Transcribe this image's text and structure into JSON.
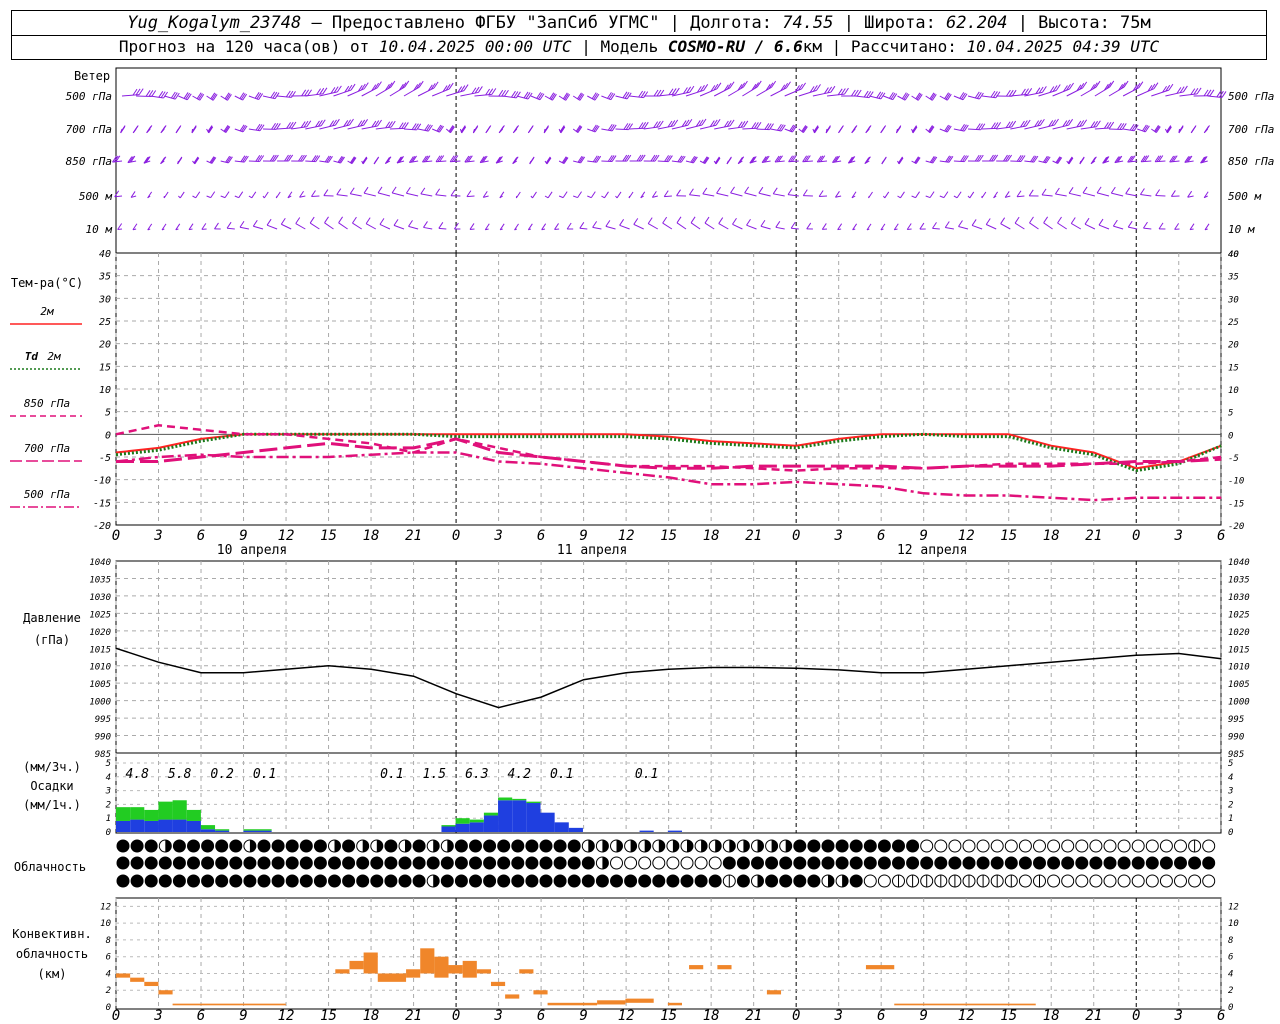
{
  "header": {
    "station": "Yug_Kogalym_23748",
    "provider": " – Предоставлено ФГБУ \"ЗапСиб УГМС\" | Долгота: ",
    "lon": "74.55",
    "lat_label": " | Широта: ",
    "lat": "62.204",
    "alt_label": " | Высота: 75м",
    "forecast_label": "Прогноз на 120 часа(ов) от ",
    "forecast_start": "10.04.2025 00:00 UTC",
    "model_label": "  | Модель ",
    "model": "COSMO-RU / 6.6",
    "model_unit": "км",
    "calc_label": " | Рассчитано: ",
    "calc_time": "10.04.2025 04:39 UTC"
  },
  "panels": {
    "wind": {
      "title": "Ветер",
      "levels": [
        "500 гПа",
        "700 гПа",
        "850 гПа",
        "500 м",
        "10  м"
      ]
    },
    "temperature": {
      "title": "Тем-ра(°С)",
      "legend": [
        {
          "label": "2м",
          "color": "#ff2222",
          "style": "solid"
        },
        {
          "label_italic": "Td",
          "label": "2м",
          "color": "#1a7a1a",
          "style": "dotted"
        },
        {
          "label": "850 гПа",
          "color": "#e0107a",
          "style": "dash"
        },
        {
          "label": "700 гПа",
          "color": "#e0107a",
          "style": "longdash"
        },
        {
          "label": "500 гПа",
          "color": "#e0107a",
          "style": "dashdot"
        }
      ]
    },
    "pressure": {
      "title": "Давление",
      "unit": "(гПа)"
    },
    "precip": {
      "unit3": "(мм/3ч.)",
      "title": "Осадки",
      "unit1": "(мм/1ч.)"
    },
    "clouds": {
      "title": "Облачность"
    },
    "convective": {
      "title1": "Конвективн.",
      "title2": "облачность",
      "unit": "(км)"
    }
  },
  "x_ticks": [
    "0",
    "3",
    "6",
    "9",
    "12",
    "15",
    "18",
    "21",
    "0",
    "3",
    "6",
    "9",
    "12",
    "15",
    "18",
    "21",
    "0",
    "3",
    "6",
    "9",
    "12",
    "15",
    "18",
    "21",
    "0",
    "3",
    "6"
  ],
  "day_labels": [
    "10 апреля",
    "11 апреля",
    "12 апреля"
  ],
  "chart_data": [
    {
      "type": "line",
      "title": "Тем-ра(°С)",
      "x": [
        0,
        3,
        6,
        9,
        12,
        15,
        18,
        21,
        24,
        27,
        30,
        33,
        36,
        39,
        42,
        45,
        48,
        51,
        54,
        57,
        60,
        63,
        66,
        69,
        72,
        75,
        78
      ],
      "ylim": [
        -20,
        40
      ],
      "yticks": [
        -20,
        -15,
        -10,
        -5,
        0,
        5,
        10,
        15,
        20,
        25,
        30,
        35,
        40
      ],
      "series": [
        {
          "name": "2м",
          "values": [
            -4,
            -3,
            -1,
            0,
            0,
            0,
            0,
            0,
            0,
            0,
            0,
            0,
            0,
            -0.5,
            -1.5,
            -2,
            -2.5,
            -1,
            0,
            0,
            0,
            0,
            -2.5,
            -4,
            -7.5,
            -6,
            -2.5
          ]
        },
        {
          "name": "Td 2м",
          "values": [
            -4.5,
            -3.5,
            -1.5,
            0,
            0,
            0,
            0,
            0,
            -0.5,
            -0.5,
            -0.5,
            -0.5,
            -0.5,
            -1,
            -2,
            -2.5,
            -3,
            -1.5,
            -0.5,
            0,
            -0.5,
            -0.5,
            -3,
            -4.5,
            -8,
            -6.5,
            -2.5
          ]
        },
        {
          "name": "850 гПа",
          "values": [
            0,
            2,
            1,
            0,
            0,
            -1,
            -2,
            -4,
            -1,
            -3,
            -5,
            -6,
            -7,
            -7,
            -7,
            -7.5,
            -8,
            -7.5,
            -7.5,
            -7.5,
            -7,
            -6.5,
            -6.5,
            -6.5,
            -6.5,
            -6,
            -5
          ]
        },
        {
          "name": "700 гПа",
          "values": [
            -6,
            -6,
            -5,
            -4,
            -3,
            -2,
            -3,
            -3,
            -1,
            -4,
            -5,
            -6,
            -7,
            -7.5,
            -7.5,
            -7,
            -7,
            -7,
            -7,
            -7.5,
            -7,
            -7,
            -7,
            -6.5,
            -6,
            -6,
            -5.5
          ]
        },
        {
          "name": "500 гПа",
          "values": [
            -6,
            -5,
            -4.5,
            -5,
            -5,
            -5,
            -4.5,
            -4,
            -4,
            -6,
            -6.5,
            -7.5,
            -8.5,
            -9.5,
            -11,
            -11,
            -10.5,
            -11,
            -11.5,
            -13,
            -13.5,
            -13.5,
            -14,
            -14.5,
            -14,
            -14,
            -14
          ]
        }
      ]
    },
    {
      "type": "line",
      "title": "Давление",
      "ylabel": "(гПа)",
      "x": [
        0,
        3,
        6,
        9,
        12,
        15,
        18,
        21,
        24,
        27,
        30,
        33,
        36,
        39,
        42,
        45,
        48,
        51,
        54,
        57,
        60,
        63,
        66,
        69,
        72,
        75,
        78
      ],
      "ylim": [
        985,
        1040
      ],
      "yticks": [
        985,
        990,
        995,
        1000,
        1005,
        1010,
        1015,
        1020,
        1025,
        1030,
        1035,
        1040
      ],
      "series": [
        {
          "name": "Давление",
          "values": [
            1015,
            1011,
            1008,
            1008,
            1009,
            1010,
            1009,
            1007,
            1002,
            998,
            1001,
            1006,
            1008,
            1009,
            1009.5,
            1009.5,
            1009.3,
            1008.8,
            1008,
            1008,
            1009,
            1010,
            1011,
            1012,
            1013,
            1013.5,
            1012
          ]
        }
      ]
    },
    {
      "type": "bar",
      "title": "Осадки",
      "ylabel": "(мм/1ч.)",
      "x": [
        0,
        1,
        2,
        3,
        4,
        5,
        6,
        7,
        8,
        9,
        10,
        11,
        12,
        13,
        14,
        15,
        16,
        17,
        18,
        19,
        20,
        21,
        22,
        23,
        24,
        25,
        26,
        27,
        28,
        29,
        30,
        31,
        32,
        33,
        34,
        35,
        36,
        37,
        38,
        39,
        40,
        41,
        42,
        43,
        44,
        45,
        46,
        47
      ],
      "ylim": [
        0,
        5
      ],
      "series": [
        {
          "name": "blue",
          "values": [
            0.8,
            0.9,
            0.8,
            0.9,
            0.9,
            0.8,
            0.2,
            0.1,
            0,
            0.1,
            0.1,
            0,
            0,
            0,
            0,
            0,
            0,
            0,
            0,
            0,
            0,
            0,
            0,
            0.4,
            0.6,
            0.7,
            1.2,
            2.3,
            2.3,
            2.1,
            1.4,
            0.7,
            0.3,
            0,
            0,
            0,
            0,
            0.1,
            0,
            0.1,
            0,
            0,
            0,
            0,
            0,
            0,
            0,
            0
          ]
        },
        {
          "name": "green",
          "values": [
            1.0,
            0.9,
            0.8,
            1.3,
            1.4,
            0.8,
            0.3,
            0.1,
            0,
            0.1,
            0.1,
            0,
            0,
            0,
            0,
            0,
            0,
            0,
            0,
            0,
            0,
            0,
            0,
            0.1,
            0.4,
            0.2,
            0.2,
            0.2,
            0.1,
            0.1,
            0,
            0,
            0,
            0,
            0,
            0,
            0,
            0,
            0,
            0,
            0,
            0,
            0,
            0,
            0,
            0,
            0,
            0
          ]
        }
      ],
      "totals_3h": [
        {
          "x": 1.5,
          "label": "4.8"
        },
        {
          "x": 4.5,
          "label": "5.8"
        },
        {
          "x": 7.5,
          "label": "0.2"
        },
        {
          "x": 10.5,
          "label": "0.1"
        },
        {
          "x": 19.5,
          "label": "0.1"
        },
        {
          "x": 22.5,
          "label": "1.5"
        },
        {
          "x": 25.5,
          "label": "6.3"
        },
        {
          "x": 28.5,
          "label": "4.2"
        },
        {
          "x": 31.5,
          "label": "0.1"
        },
        {
          "x": 37.5,
          "label": "0.1"
        }
      ]
    },
    {
      "type": "table",
      "title": "Облачность",
      "rows": [
        "fffhfffffhfffffhfhhfhfhhfffffffffhhhhhhhhhhhhhhhfffffffffoooooooooooooooooooqoooooooooooooooooqfh",
        "ffffffffffffffffffffffffffffffffffhoooooooofffffffffffffffffffffffffffffffffffffffffffhooooooooooo",
        "ffffffffffffffffffffffhffffffffffffffffffffqfhffffhhfooqqqqqqqqqoqooooooooooooooooooooooooffhfffff"
      ]
    },
    {
      "type": "bar",
      "title": "Конвективн. облачность",
      "ylabel": "(км)",
      "ylim": [
        0,
        13
      ],
      "yticks": [
        0,
        2,
        4,
        6,
        8,
        10,
        12
      ],
      "segments": [
        {
          "x0": 0,
          "x1": 1,
          "bottom": 3.5,
          "top": 4
        },
        {
          "x0": 1,
          "x1": 2,
          "bottom": 3,
          "top": 3.5
        },
        {
          "x0": 2,
          "x1": 3,
          "bottom": 2.5,
          "top": 3
        },
        {
          "x0": 3,
          "x1": 4,
          "bottom": 1.5,
          "top": 2
        },
        {
          "x0": 4,
          "x1": 12,
          "bottom": 0.2,
          "top": 0.4
        },
        {
          "x0": 15.5,
          "x1": 16.5,
          "bottom": 4,
          "top": 4.5
        },
        {
          "x0": 16.5,
          "x1": 17.5,
          "bottom": 4.5,
          "top": 5.5
        },
        {
          "x0": 17.5,
          "x1": 18.5,
          "bottom": 4,
          "top": 6.5
        },
        {
          "x0": 18.5,
          "x1": 20.5,
          "bottom": 3,
          "top": 4
        },
        {
          "x0": 20.5,
          "x1": 21.5,
          "bottom": 3.5,
          "top": 4.5
        },
        {
          "x0": 21.5,
          "x1": 22.5,
          "bottom": 4,
          "top": 7
        },
        {
          "x0": 22.5,
          "x1": 23.5,
          "bottom": 3.5,
          "top": 6
        },
        {
          "x0": 23.5,
          "x1": 24.5,
          "bottom": 4,
          "top": 5
        },
        {
          "x0": 24.5,
          "x1": 25.5,
          "bottom": 3.5,
          "top": 5.5
        },
        {
          "x0": 25.5,
          "x1": 26.5,
          "bottom": 4,
          "top": 4.5
        },
        {
          "x0": 26.5,
          "x1": 27.5,
          "bottom": 2.5,
          "top": 3
        },
        {
          "x0": 27.5,
          "x1": 28.5,
          "bottom": 1,
          "top": 1.5
        },
        {
          "x0": 28.5,
          "x1": 29.5,
          "bottom": 4,
          "top": 4.5
        },
        {
          "x0": 29.5,
          "x1": 30.5,
          "bottom": 1.5,
          "top": 2
        },
        {
          "x0": 30.5,
          "x1": 34,
          "bottom": 0.2,
          "top": 0.5
        },
        {
          "x0": 34,
          "x1": 36,
          "bottom": 0.3,
          "top": 0.8
        },
        {
          "x0": 36,
          "x1": 38,
          "bottom": 0.5,
          "top": 1.0
        },
        {
          "x0": 39,
          "x1": 40,
          "bottom": 0.2,
          "top": 0.5
        },
        {
          "x0": 40.5,
          "x1": 41.5,
          "bottom": 4.5,
          "top": 5
        },
        {
          "x0": 42.5,
          "x1": 43.5,
          "bottom": 4.5,
          "top": 5
        },
        {
          "x0": 46,
          "x1": 47,
          "bottom": 1.5,
          "top": 2
        },
        {
          "x0": 53,
          "x1": 55,
          "bottom": 4.5,
          "top": 5
        },
        {
          "x0": 55,
          "x1": 65,
          "bottom": 0.2,
          "top": 0.4
        }
      ]
    }
  ]
}
